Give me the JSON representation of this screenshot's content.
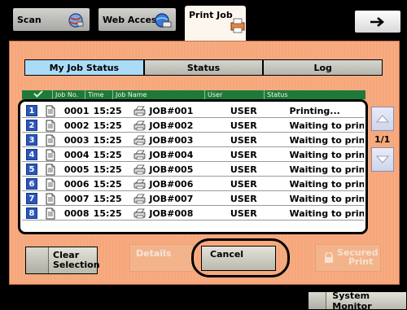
{
  "top_tabs": [
    {
      "label": "Scan",
      "icon": "scan-globe-icon"
    },
    {
      "label": "Web Access",
      "icon": "web-globe-icon"
    },
    {
      "label": "Print Job",
      "icon": "print-job-icon"
    }
  ],
  "nav": {
    "next_icon": "right-arrow-icon"
  },
  "sub_tabs": [
    {
      "label": "My Job Status",
      "active": true
    },
    {
      "label": "Status",
      "active": false
    },
    {
      "label": "Log",
      "active": false
    }
  ],
  "table": {
    "columns": [
      "Job No.",
      "Time",
      "Job Name",
      "User",
      "Status"
    ],
    "rows": [
      {
        "index": "1",
        "job_no": "0001",
        "time": "15:25",
        "job_name": "JOB#001",
        "user": "USER",
        "status": "Printing..."
      },
      {
        "index": "2",
        "job_no": "0002",
        "time": "15:25",
        "job_name": "JOB#002",
        "user": "USER",
        "status": "Waiting to print."
      },
      {
        "index": "3",
        "job_no": "0003",
        "time": "15:25",
        "job_name": "JOB#003",
        "user": "USER",
        "status": "Waiting to print."
      },
      {
        "index": "4",
        "job_no": "0004",
        "time": "15:25",
        "job_name": "JOB#004",
        "user": "USER",
        "status": "Waiting to print."
      },
      {
        "index": "5",
        "job_no": "0005",
        "time": "15:25",
        "job_name": "JOB#005",
        "user": "USER",
        "status": "Waiting to print."
      },
      {
        "index": "6",
        "job_no": "0006",
        "time": "15:25",
        "job_name": "JOB#006",
        "user": "USER",
        "status": "Waiting to print."
      },
      {
        "index": "7",
        "job_no": "0007",
        "time": "15:25",
        "job_name": "JOB#007",
        "user": "USER",
        "status": "Waiting to print."
      },
      {
        "index": "8",
        "job_no": "0008",
        "time": "15:25",
        "job_name": "JOB#008",
        "user": "USER",
        "status": "Waiting to print."
      }
    ]
  },
  "pagination": {
    "page": "1/1"
  },
  "buttons": {
    "clear_selection_line1": "Clear",
    "clear_selection_line2": "Selection",
    "details": "Details",
    "cancel": "Cancel",
    "secured_line1": "Secured",
    "secured_line2": "Print"
  },
  "status_bar": {
    "system_monitor": "System Monitor"
  },
  "colors": {
    "panel": "#f6a77a",
    "header_green": "#1f7a3a",
    "row_number_blue": "#2c56b8",
    "active_subtab": "#aadcf8"
  }
}
